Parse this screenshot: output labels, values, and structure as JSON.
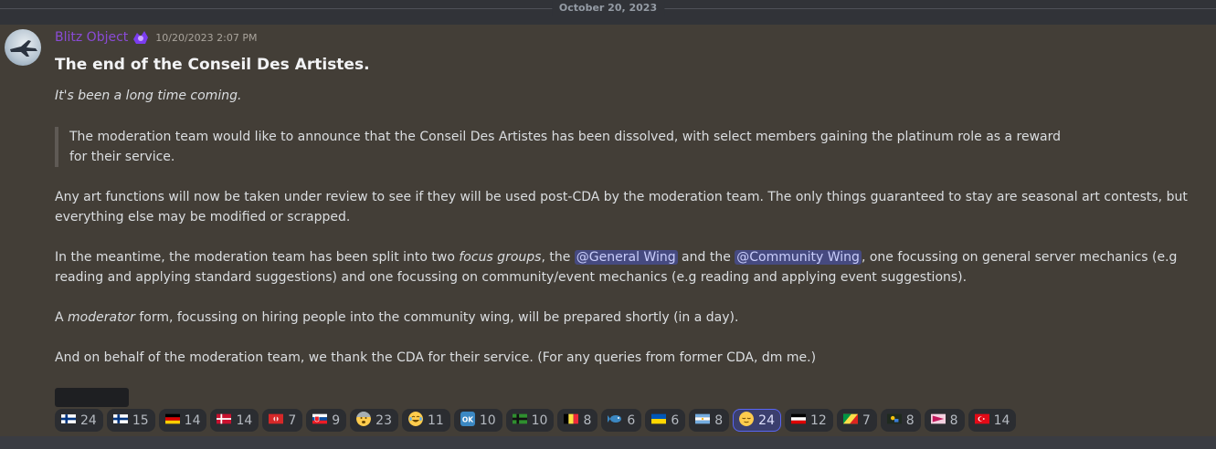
{
  "date_divider": "October 20, 2023",
  "message": {
    "author": "Blitz Object",
    "role_icon": "purple-role-icon",
    "timestamp": "10/20/2023 2:07 PM",
    "title": "The end of the Conseil Des Artistes.",
    "subtitle": "It's been a long time coming.",
    "quote": "The moderation team would like to announce that the Conseil Des Artistes has been dissolved, with select members gaining the platinum role as a reward for their service.",
    "para1": "Any art functions will now be taken under review to see if they will be used post-CDA by the moderation team. The only things guaranteed to stay are seasonal art contests, but everything else may be modified or scrapped.",
    "para2": {
      "part1": "In the meantime, the moderation team has been split into two ",
      "italic": "focus groups",
      "part2": ", the ",
      "mention1": "@General Wing",
      "part3": " and the ",
      "mention2": "@Community Wing",
      "part4": ", one focussing on general server mechanics (e.g reading and applying standard suggestions) and one focussing on community/event mechanics (e.g reading and applying event suggestions)."
    },
    "para3": {
      "part1": "A ",
      "italic": "moderator",
      "part2": " form, focussing on hiring people into the community wing, will be prepared shortly (in a day)."
    },
    "para4": "And on behalf of the moderation team, we thank the CDA for their service. (For any queries from former CDA, dm me.)"
  },
  "reactions": [
    {
      "icon": "finland-flag",
      "count": "24"
    },
    {
      "icon": "finland-flag-alt",
      "count": "15"
    },
    {
      "icon": "germany-flag",
      "count": "14"
    },
    {
      "icon": "denmark-flag",
      "count": "14"
    },
    {
      "icon": "custom-red-flag",
      "count": "7"
    },
    {
      "icon": "slovakia-flag",
      "count": "9"
    },
    {
      "icon": "fearful-face-emoji",
      "count": "23"
    },
    {
      "icon": "joy-emoji",
      "count": "11"
    },
    {
      "icon": "ok-button-emoji",
      "count": "10"
    },
    {
      "icon": "green-cross-flag",
      "count": "10"
    },
    {
      "icon": "belgium-flag",
      "count": "8"
    },
    {
      "icon": "fish-emoji",
      "count": "6"
    },
    {
      "icon": "ukraine-flag",
      "count": "6"
    },
    {
      "icon": "argentina-flag",
      "count": "8"
    },
    {
      "icon": "relieved-face-emoji",
      "count": "24",
      "active": true
    },
    {
      "icon": "german-empire-flag",
      "count": "12"
    },
    {
      "icon": "congo-flag",
      "count": "7"
    },
    {
      "icon": "custom-dark-flag",
      "count": "8"
    },
    {
      "icon": "custom-pink-flag",
      "count": "8"
    },
    {
      "icon": "turkey-flag",
      "count": "14"
    }
  ]
}
